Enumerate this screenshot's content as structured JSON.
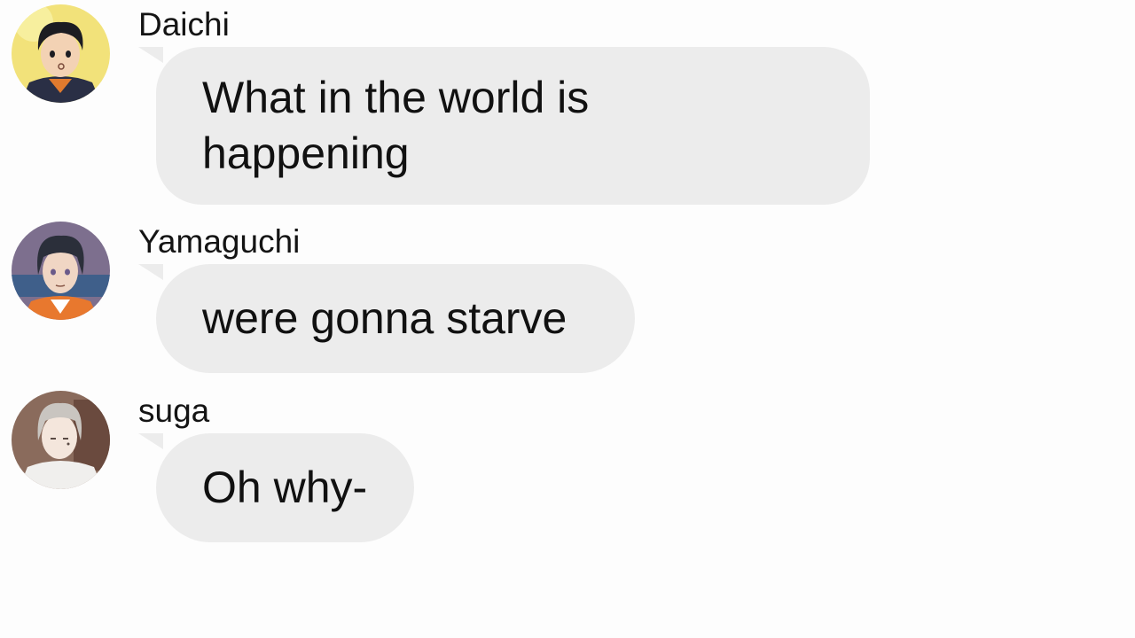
{
  "messages": [
    {
      "sender": "Daichi",
      "text": "What in the world is\nhappening",
      "avatar_icon": "daichi-avatar-icon",
      "avatar_colors": {
        "bg": "#f2e27a",
        "hair": "#1c1c22",
        "skin": "#f3d2b4",
        "jacket": "#2a2f45",
        "accent": "#e07a2e"
      }
    },
    {
      "sender": "Yamaguchi",
      "text": "were gonna starve",
      "avatar_icon": "yamaguchi-avatar-icon",
      "avatar_colors": {
        "bg": "#7d6f8e",
        "hair": "#2b2f3a",
        "skin": "#f0d6c4",
        "jacket": "#e8782e",
        "accent": "#ffffff"
      }
    },
    {
      "sender": "suga",
      "text": "Oh why-",
      "avatar_icon": "suga-avatar-icon",
      "avatar_colors": {
        "bg": "#8a6b5c",
        "hair": "#c9c5c0",
        "skin": "#f4e6dc",
        "jacket": "#f0efed",
        "accent": "#6a4a3e"
      }
    }
  ],
  "colors": {
    "background": "#fdfdfd",
    "bubble": "#ececec",
    "text": "#111111"
  }
}
